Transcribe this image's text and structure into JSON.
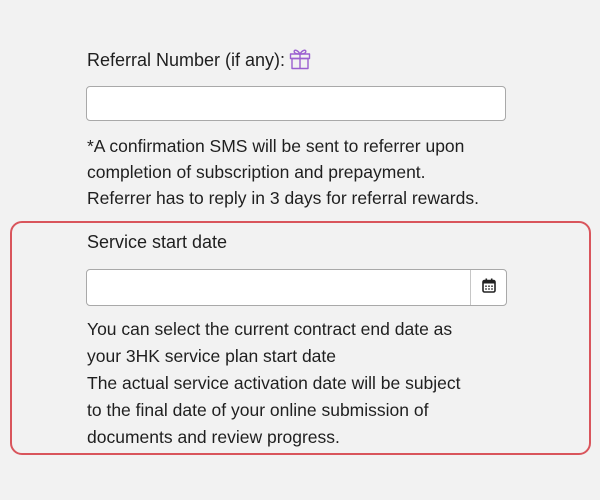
{
  "referral": {
    "label": "Referral Number (if any):",
    "icon": "gift-icon",
    "icon_color": "#9b5fd0",
    "input_value": "",
    "note_lines": [
      "*A confirmation SMS will be sent to referrer upon",
      "completion of subscription and prepayment.",
      "Referrer has to reply in 3 days for referral rewards."
    ]
  },
  "service_start": {
    "label": "Service start date",
    "input_value": "",
    "calendar_icon": "calendar-icon",
    "highlight_border_color": "#d9555c",
    "note_lines": [
      "You can select the current contract end date as",
      "your 3HK service plan start date",
      "The actual service activation date will be subject",
      "to the final date of your online submission of",
      "documents and review progress."
    ]
  }
}
